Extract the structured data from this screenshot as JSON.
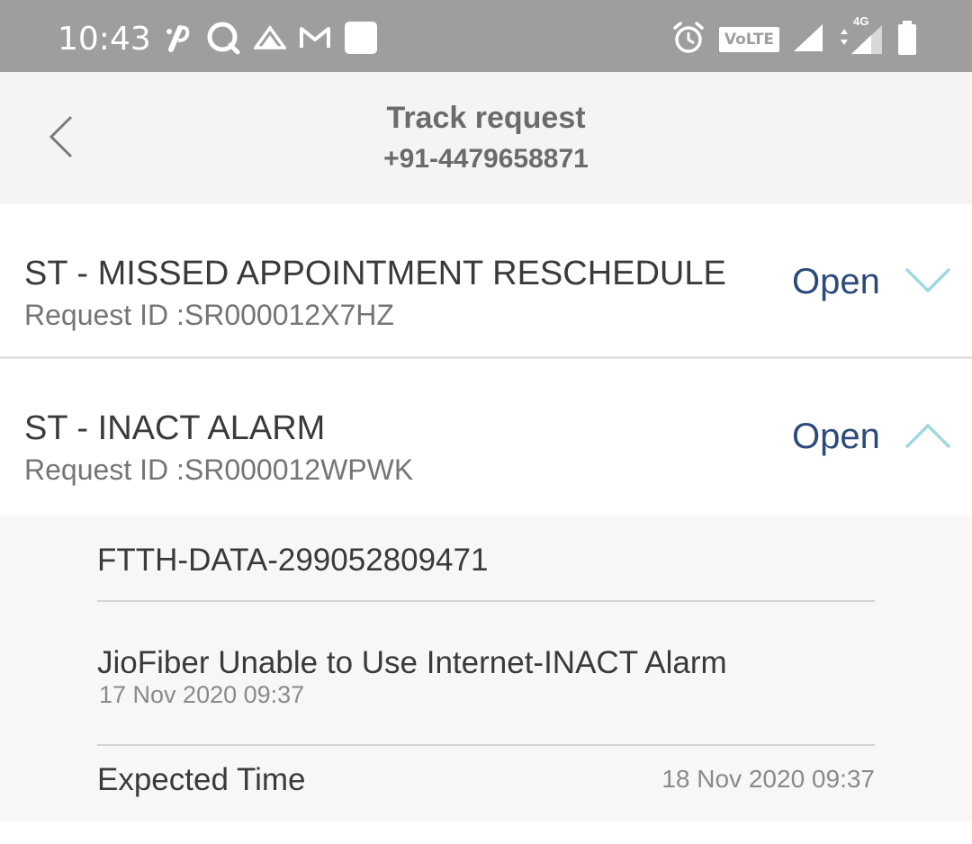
{
  "status_bar": {
    "time": "10:43",
    "volte_label": "VoLTE",
    "network_label": "4G"
  },
  "header": {
    "title": "Track request",
    "subtitle": "+91-4479658871"
  },
  "requests": [
    {
      "title": "ST - MISSED APPOINTMENT RESCHEDULE",
      "request_id": "Request ID :SR000012X7HZ",
      "status": "Open",
      "expanded": false
    },
    {
      "title": "ST - INACT ALARM",
      "request_id": "Request ID :SR000012WPWK",
      "status": "Open",
      "expanded": true
    }
  ],
  "details": {
    "service_id": "FTTH-DATA-299052809471",
    "issue": "JioFiber Unable to Use Internet-INACT Alarm",
    "issue_time": "17 Nov 2020 09:37",
    "expected_label": "Expected Time",
    "expected_time": "18 Nov 2020 09:37"
  },
  "colors": {
    "status_bar": "#9e9e9e",
    "header_bg": "#f4f4f4",
    "status_text": "#2c4a7a",
    "chevron": "#9fd8df"
  }
}
